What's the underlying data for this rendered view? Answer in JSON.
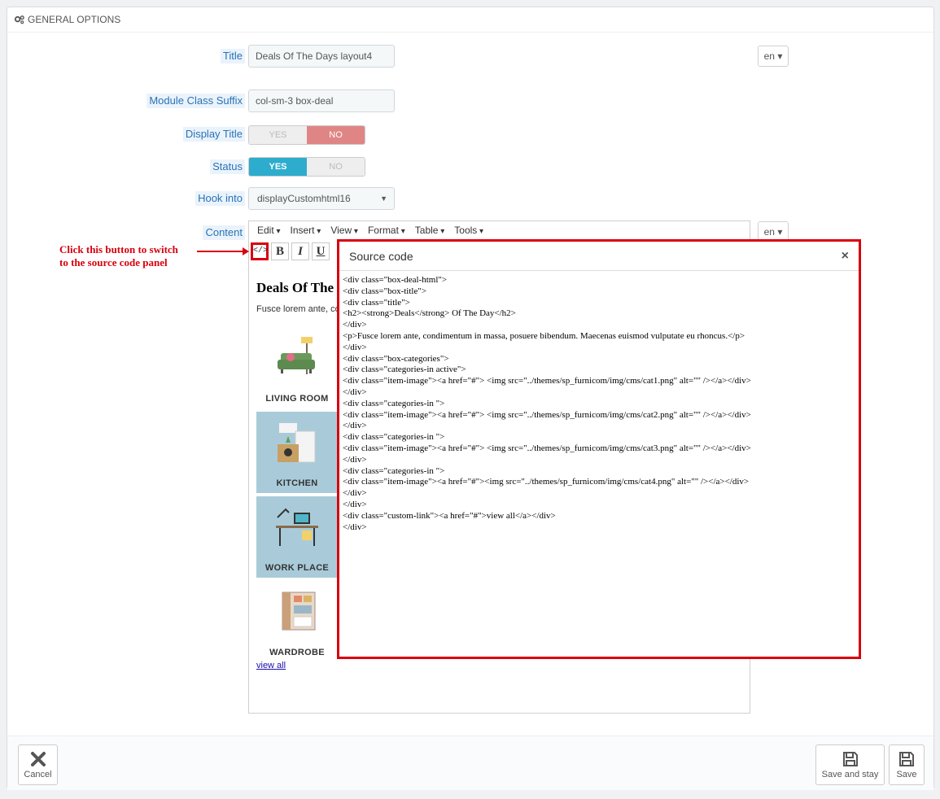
{
  "section_title": "GENERAL OPTIONS",
  "fields": {
    "title_label": "Title",
    "title_value": "Deals Of The Days layout4",
    "suffix_label": "Module Class Suffix",
    "suffix_value": "col-sm-3 box-deal",
    "display_title_label": "Display Title",
    "status_label": "Status",
    "hook_label": "Hook into",
    "hook_value": "displayCustomhtml16",
    "content_label": "Content"
  },
  "toggles": {
    "yes": "YES",
    "no": "NO",
    "display_title_selected": "NO",
    "status_selected": "YES"
  },
  "language": {
    "code": "en"
  },
  "editor": {
    "menus": [
      "Edit",
      "Insert",
      "View",
      "Format",
      "Table",
      "Tools"
    ],
    "toolbar": {
      "source": "</>",
      "bold": "B",
      "italic": "I",
      "underline": "U"
    },
    "heading": "Deals Of The",
    "paragraph": "Fusce lorem ante, co",
    "categories": [
      "LIVING ROOM",
      "KITCHEN",
      "WORK PLACE",
      "WARDROBE"
    ],
    "view_all": "view all"
  },
  "annotation": {
    "line1": "Click this button to switch",
    "line2": "to the source code panel"
  },
  "modal": {
    "title": "Source code",
    "close": "×",
    "code": "<div class=\"box-deal-html\">\n<div class=\"box-title\">\n<div class=\"title\">\n<h2><strong>Deals</strong> Of The Day</h2>\n</div>\n<p>Fusce lorem ante, condimentum in massa, posuere bibendum. Maecenas euismod vulputate eu rhoncus.</p>\n</div>\n<div class=\"box-categories\">\n<div class=\"categories-in active\">\n<div class=\"item-image\"><a href=\"#\"> <img src=\"../themes/sp_furnicom/img/cms/cat1.png\" alt=\"\" /></a></div>\n</div>\n<div class=\"categories-in \">\n<div class=\"item-image\"><a href=\"#\"> <img src=\"../themes/sp_furnicom/img/cms/cat2.png\" alt=\"\" /></a></div>\n</div>\n<div class=\"categories-in \">\n<div class=\"item-image\"><a href=\"#\"> <img src=\"../themes/sp_furnicom/img/cms/cat3.png\" alt=\"\" /></a></div>\n</div>\n<div class=\"categories-in \">\n<div class=\"item-image\"><a href=\"#\"><img src=\"../themes/sp_furnicom/img/cms/cat4.png\" alt=\"\" /></a></div>\n</div>\n</div>\n<div class=\"custom-link\"><a href=\"#\">view all</a></div>\n</div>"
  },
  "footer": {
    "cancel": "Cancel",
    "save_and_stay": "Save and stay",
    "save": "Save"
  }
}
